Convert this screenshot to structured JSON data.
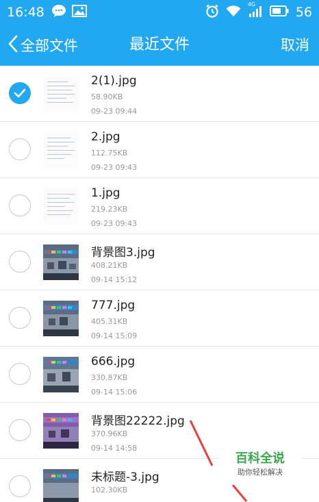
{
  "status": {
    "time": "16:48",
    "battery": "56",
    "signal_label": "4G"
  },
  "header": {
    "back_label": "全部文件",
    "title": "最近文件",
    "cancel_label": "取消"
  },
  "files": [
    {
      "name": "2(1).jpg",
      "size": "58.90KB",
      "date": "09-23 09:44",
      "checked": true,
      "thumb": "doc"
    },
    {
      "name": "2.jpg",
      "size": "112.75KB",
      "date": "09-23 09:43",
      "checked": false,
      "thumb": "doc"
    },
    {
      "name": "1.jpg",
      "size": "219.23KB",
      "date": "09-23 09:43",
      "checked": false,
      "thumb": "doc"
    },
    {
      "name": "背景图3.jpg",
      "size": "408.21KB",
      "date": "09-14 15:12",
      "checked": false,
      "thumb": "photo"
    },
    {
      "name": "777.jpg",
      "size": "405.31KB",
      "date": "09-14 15:09",
      "checked": false,
      "thumb": "photo"
    },
    {
      "name": "666.jpg",
      "size": "330.87KB",
      "date": "09-14 15:06",
      "checked": false,
      "thumb": "photo"
    },
    {
      "name": "背景图22222.jpg",
      "size": "370.96KB",
      "date": "09-14 14:58",
      "checked": false,
      "thumb": "purple"
    },
    {
      "name": "未标题-3.jpg",
      "size": "102.30KB",
      "date": "",
      "checked": false,
      "thumb": "photo"
    }
  ],
  "watermark": {
    "main": "百科全说",
    "sub": "助你轻松解决"
  },
  "colors": {
    "accent": "#22a8f0",
    "watermark_green": "#3aa84a"
  }
}
